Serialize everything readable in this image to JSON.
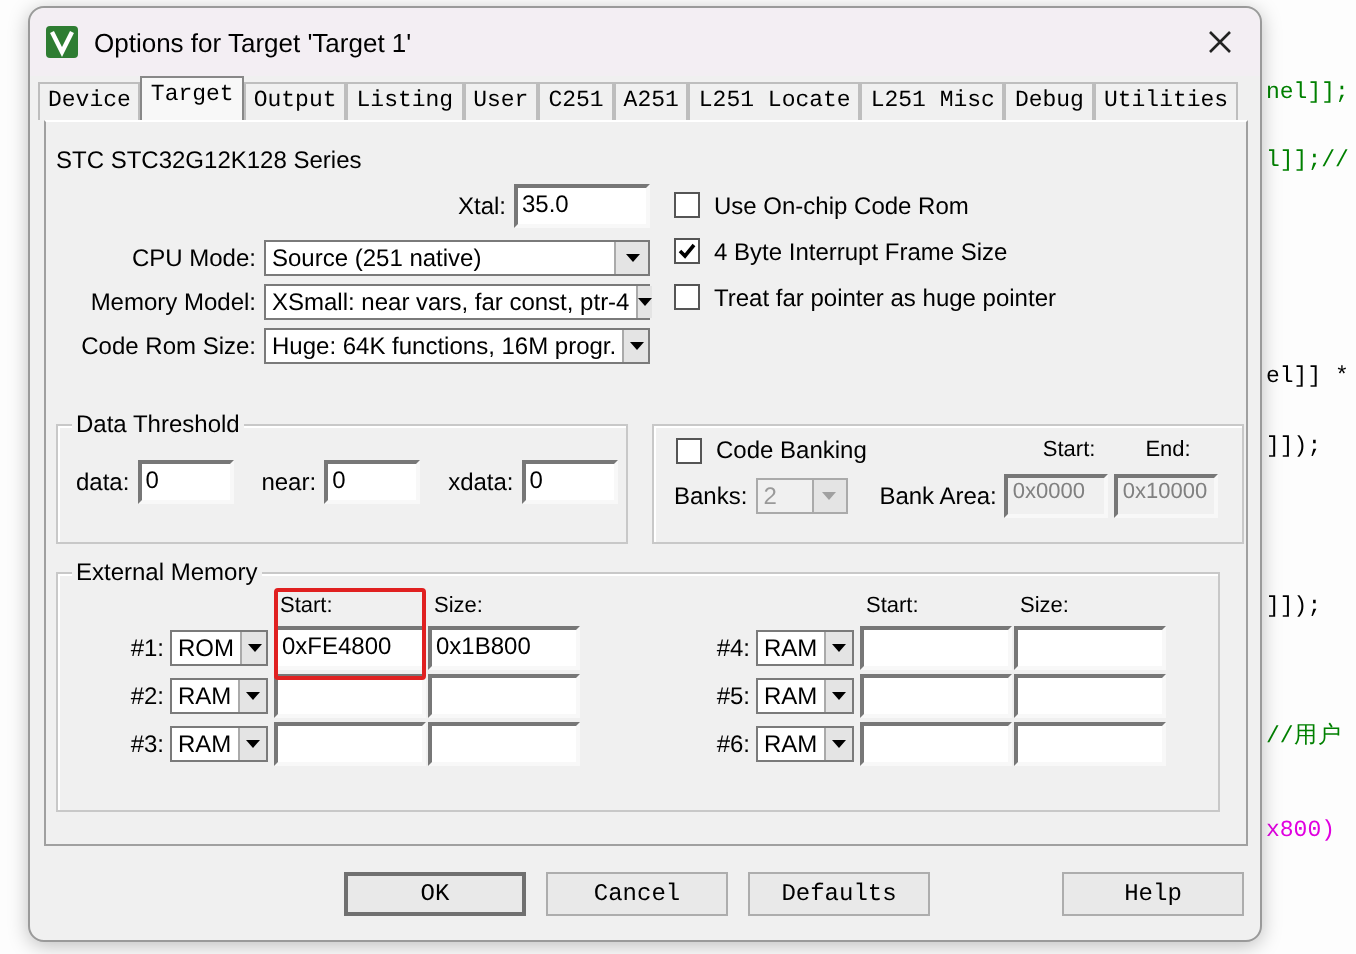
{
  "editor": {
    "lines": [
      {
        "text": "nel]];",
        "color": "#008000"
      },
      {
        "text": "l]];//",
        "color": "#008000"
      },
      {
        "text": "el]] *",
        "color": "#000000"
      },
      {
        "text": "]]);",
        "color": "#000000"
      },
      {
        "text": "]]);",
        "color": "#000000"
      },
      {
        "text": "//用户",
        "color": "#008000"
      },
      {
        "text": "x800)",
        "color": "#e000e0"
      }
    ]
  },
  "window": {
    "title": "Options for Target 'Target 1'"
  },
  "tabs": [
    {
      "label": "Device",
      "selected": false
    },
    {
      "label": "Target",
      "selected": true
    },
    {
      "label": "Output",
      "selected": false
    },
    {
      "label": "Listing",
      "selected": false
    },
    {
      "label": "User",
      "selected": false
    },
    {
      "label": "C251",
      "selected": false
    },
    {
      "label": "A251",
      "selected": false
    },
    {
      "label": "L251 Locate",
      "selected": false
    },
    {
      "label": "L251 Misc",
      "selected": false
    },
    {
      "label": "Debug",
      "selected": false
    },
    {
      "label": "Utilities",
      "selected": false
    }
  ],
  "device_name": "STC STC32G12K128 Series",
  "xtal": {
    "label": "Xtal:",
    "value": "35.0"
  },
  "selects": [
    {
      "label": "CPU Mode:",
      "value": "Source (251 native)"
    },
    {
      "label": "Memory Model:",
      "value": "XSmall: near vars, far const, ptr-4"
    },
    {
      "label": "Code Rom Size:",
      "value": "Huge: 64K functions, 16M progr."
    }
  ],
  "options": [
    {
      "label": "Use On-chip Code Rom",
      "checked": false
    },
    {
      "label": "4 Byte Interrupt Frame Size",
      "checked": true
    },
    {
      "label": "Treat far pointer as huge pointer",
      "checked": false
    }
  ],
  "data_threshold": {
    "title": "Data Threshold",
    "fields": [
      {
        "label": "data:",
        "value": "0"
      },
      {
        "label": "near:",
        "value": "0"
      },
      {
        "label": "xdata:",
        "value": "0"
      }
    ]
  },
  "code_banking": {
    "label": "Code Banking",
    "checked": false,
    "banks_label": "Banks:",
    "banks": "2",
    "start_label": "Start:",
    "end_label": "End:",
    "area_label": "Bank Area:",
    "start": "0x0000",
    "end": "0x10000",
    "disabled": true
  },
  "external_memory": {
    "title": "External Memory",
    "columns": [
      {
        "start_label": "Start:",
        "size_label": "Size:",
        "rows": [
          {
            "label": "#1:",
            "type": "ROM",
            "start": "0xFE4800",
            "size": "0x1B800"
          },
          {
            "label": "#2:",
            "type": "RAM"
          },
          {
            "label": "#3:",
            "type": "RAM"
          }
        ]
      },
      {
        "start_label": "Start:",
        "size_label": "Size:",
        "rows": [
          {
            "label": "#4:",
            "type": "RAM"
          },
          {
            "label": "#5:",
            "type": "RAM"
          },
          {
            "label": "#6:",
            "type": "RAM"
          }
        ]
      }
    ],
    "annotation": {
      "kind": "rectangle",
      "color": "#e02020"
    }
  },
  "buttons": [
    {
      "label": "OK",
      "kind": "default"
    },
    {
      "label": "Cancel",
      "kind": "normal"
    },
    {
      "label": "Defaults",
      "kind": "normal"
    },
    {
      "label": "Help",
      "kind": "normal"
    }
  ]
}
